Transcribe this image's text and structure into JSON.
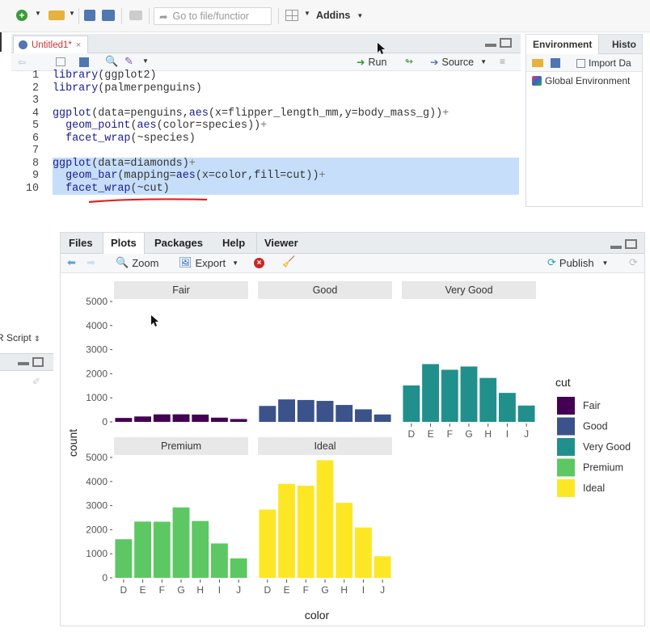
{
  "toolbar": {
    "goto_placeholder": "Go to file/function",
    "goto_display": "Go to file/functior",
    "addins_label": "Addins"
  },
  "source": {
    "tab_label": "Untitled1*",
    "run_label": "Run",
    "source_label": "Source",
    "lines": [
      {
        "num": "1",
        "code": "library(ggplot2)",
        "selected": false
      },
      {
        "num": "2",
        "code": "library(palmerpenguins)",
        "selected": false
      },
      {
        "num": "3",
        "code": "",
        "selected": false
      },
      {
        "num": "4",
        "code": "ggplot(data=penguins,aes(x=flipper_length_mm,y=body_mass_g))+",
        "selected": false
      },
      {
        "num": "5",
        "code": "  geom_point(aes(color=species))+",
        "selected": false
      },
      {
        "num": "6",
        "code": "  facet_wrap(~species)",
        "selected": false
      },
      {
        "num": "7",
        "code": "",
        "selected": false
      },
      {
        "num": "8",
        "code": "ggplot(data=diamonds)+",
        "selected": true
      },
      {
        "num": "9",
        "code": "  geom_bar(mapping=aes(x=color,fill=cut))+",
        "selected": true
      },
      {
        "num": "10",
        "code": "  facet_wrap(~cut)",
        "selected": true
      }
    ]
  },
  "environment": {
    "tab_env": "Environment",
    "tab_history": "Histo",
    "import_label": "Import Da",
    "global_env_label": "Global Environment"
  },
  "left_strip": {
    "script_label": "R Script"
  },
  "plots_pane": {
    "tabs": [
      "Files",
      "Plots",
      "Packages",
      "Help",
      "Viewer"
    ],
    "active_tab": "Plots",
    "zoom_label": "Zoom",
    "export_label": "Export",
    "publish_label": "Publish"
  },
  "chart_data": {
    "type": "bar",
    "facets": [
      "Fair",
      "Good",
      "Very Good",
      "Premium",
      "Ideal"
    ],
    "categories": [
      "D",
      "E",
      "F",
      "G",
      "H",
      "I",
      "J"
    ],
    "series": [
      {
        "name": "Fair",
        "values": [
          163,
          224,
          312,
          314,
          303,
          175,
          119
        ]
      },
      {
        "name": "Good",
        "values": [
          662,
          933,
          909,
          871,
          702,
          522,
          307
        ]
      },
      {
        "name": "Very Good",
        "values": [
          1513,
          2400,
          2164,
          2299,
          1824,
          1204,
          678
        ]
      },
      {
        "name": "Premium",
        "values": [
          1603,
          2337,
          2331,
          2924,
          2360,
          1428,
          808
        ]
      },
      {
        "name": "Ideal",
        "values": [
          2834,
          3903,
          3826,
          4884,
          3115,
          2093,
          896
        ]
      }
    ],
    "xlabel": "color",
    "ylabel": "count",
    "ylim": [
      0,
      5000
    ],
    "yticks": [
      0,
      1000,
      2000,
      3000,
      4000,
      5000
    ],
    "legend_title": "cut",
    "legend_position": "right",
    "colors": [
      "#440154",
      "#3b528b",
      "#21908c",
      "#5dc863",
      "#fde725"
    ]
  }
}
